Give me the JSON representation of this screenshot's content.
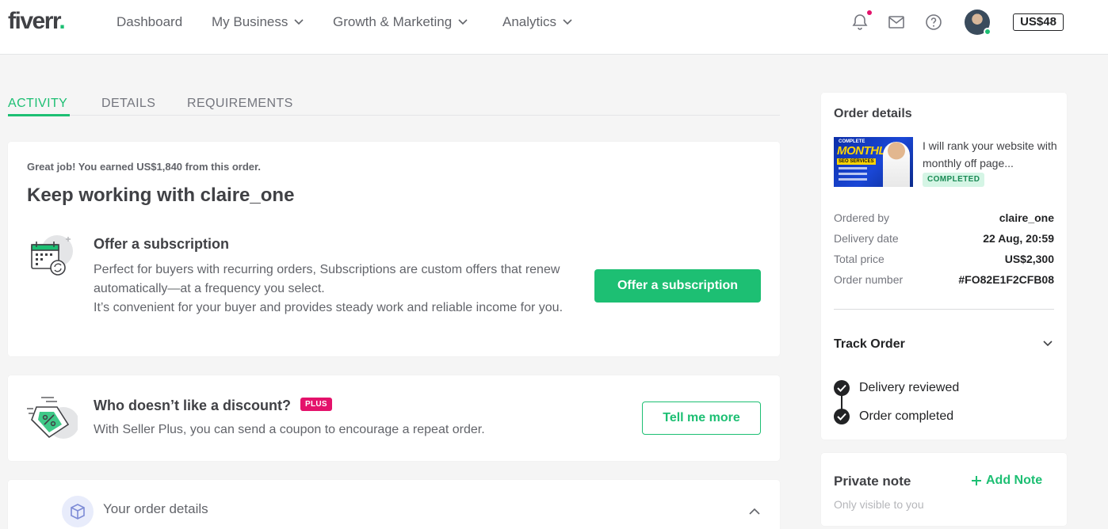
{
  "brand": {
    "logo_text": "fiverr",
    "logo_dot": ".",
    "accent_color": "#1dbf73"
  },
  "nav": {
    "items": [
      {
        "label": "Dashboard",
        "has_dropdown": false
      },
      {
        "label": "My Business",
        "has_dropdown": true
      },
      {
        "label": "Growth & Marketing",
        "has_dropdown": true
      },
      {
        "label": "Analytics",
        "has_dropdown": true
      }
    ],
    "icons": [
      "bell-icon",
      "mail-icon",
      "help-icon"
    ],
    "balance": "US$48"
  },
  "tabs": [
    {
      "label": "Activity",
      "active": true
    },
    {
      "label": "Details",
      "active": false
    },
    {
      "label": "Requirements",
      "active": false
    }
  ],
  "keep_working": {
    "earned_text": "Great job! You earned US$1,840 from this order.",
    "title": "Keep working with claire_one",
    "offer_title": "Offer a subscription",
    "offer_desc_1": "Perfect for buyers with recurring orders, Subscriptions are custom offers that renew automatically—at a frequency you select.",
    "offer_desc_2": "It’s convenient for your buyer and provides steady work and reliable income for you.",
    "offer_button": "Offer a subscription"
  },
  "discount": {
    "title": "Who doesn’t like a discount?",
    "badge": "PLUS",
    "desc": "With Seller Plus, you can send a coupon to encourage a repeat order.",
    "button": "Tell me more"
  },
  "your_order_details": {
    "title": "Your order details"
  },
  "order_details": {
    "title": "Order details",
    "gig_thumb": {
      "line1": "COMPLETE",
      "line2": "MONTHLY",
      "line3": "SEO SERVICES"
    },
    "gig_title": "I will rank your website with monthly off page...",
    "status": "COMPLETED",
    "rows": [
      {
        "key": "Ordered by",
        "value": "claire_one"
      },
      {
        "key": "Delivery date",
        "value": "22 Aug, 20:59"
      },
      {
        "key": "Total price",
        "value": "US$2,300"
      },
      {
        "key": "Order number",
        "value": "#FO82E1F2CFB08"
      }
    ],
    "track_title": "Track Order",
    "track_steps": [
      "Delivery reviewed",
      "Order completed"
    ]
  },
  "private_note": {
    "title": "Private note",
    "add_label": "Add Note",
    "subtitle": "Only visible to you"
  }
}
